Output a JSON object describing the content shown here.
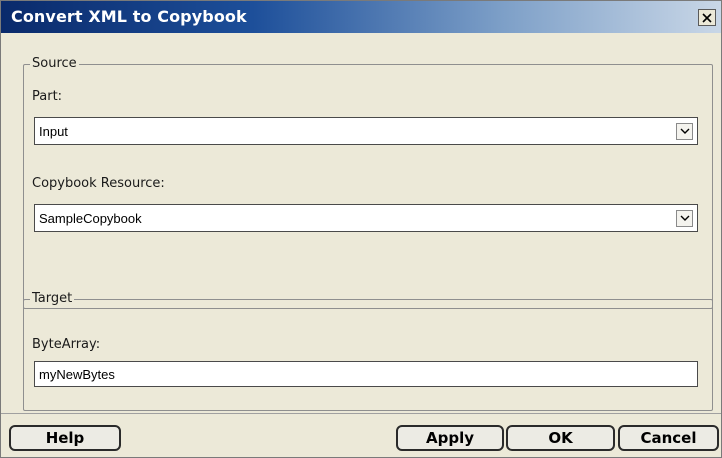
{
  "window": {
    "title": "Convert XML to Copybook"
  },
  "source": {
    "legend": "Source",
    "part": {
      "label": "Part:",
      "value": "Input"
    },
    "copybook": {
      "label": "Copybook Resource:",
      "value": "SampleCopybook"
    }
  },
  "target": {
    "legend": "Target",
    "bytearray": {
      "label": "ByteArray:",
      "value": "myNewBytes"
    }
  },
  "buttons": {
    "help": "Help",
    "apply": "Apply",
    "ok": "OK",
    "cancel": "Cancel"
  },
  "icons": {
    "close": "close-icon",
    "dropdown": "chevron-down-icon"
  },
  "colors": {
    "titlebar_start": "#0a2a6b",
    "titlebar_end": "#c9d7e7",
    "dialog_bg": "#ece9d8"
  }
}
